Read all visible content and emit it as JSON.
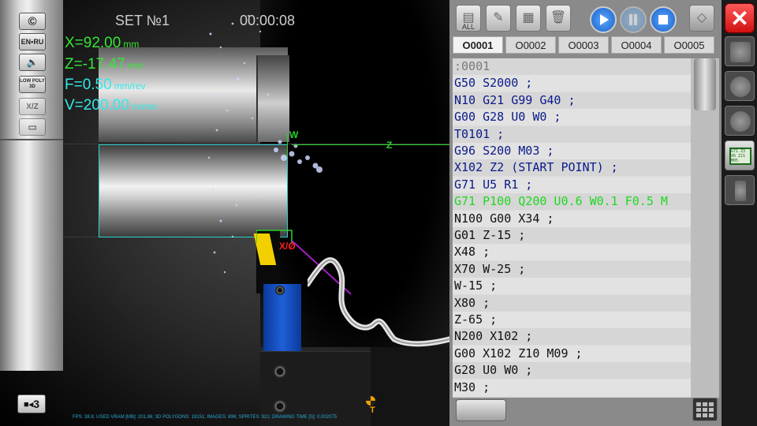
{
  "viewport": {
    "set_label": "SET №1",
    "timer": "00:00:08",
    "readouts": [
      {
        "label": "X=92.00",
        "unit": "mm",
        "color": "green"
      },
      {
        "label": "Z=-17.47",
        "unit": "mm",
        "color": "green"
      },
      {
        "label": "F=0.50",
        "unit": "mm/rev",
        "color": "cyan"
      },
      {
        "label": "V=200.00",
        "unit": "m/min",
        "color": "cyan"
      }
    ],
    "left_buttons": [
      "©",
      "EN•RU",
      "🔈",
      "LOW POLY 3D",
      "X/Z",
      "▭"
    ],
    "axis_w": "W",
    "axis_z": "Z",
    "tool_axis": "X/Ø",
    "marker_t": "T",
    "camera_button": "3",
    "status_bar": "FPS: 38.8; USED VRAM [MB]: 201.86; 3D POLYGONS: 19151; IMAGES: 896; SPRITES: 921; DRAWING TIME [S]: 0.002075"
  },
  "editor": {
    "toolbar": [
      {
        "name": "new-all-icon",
        "label": "ALL"
      },
      {
        "name": "edit-icon",
        "label": ""
      },
      {
        "name": "paste-icon",
        "label": ""
      },
      {
        "name": "trash-icon",
        "label": ""
      },
      {
        "name": "play-icon",
        "label": ""
      },
      {
        "name": "pause-icon",
        "label": ""
      },
      {
        "name": "stop-icon",
        "label": ""
      },
      {
        "name": "eraser-icon",
        "label": ""
      }
    ],
    "tabs": [
      "O0001",
      "O0002",
      "O0003",
      "O0004",
      "O0005"
    ],
    "active_tab": 0,
    "lines": [
      {
        "text": ":0001",
        "color": "#7a7a7a"
      },
      {
        "text": "G50 S2000 ;",
        "color": "#0a1a8a"
      },
      {
        "text": "N10 G21 G99 G40 ;",
        "color": "#0a1a8a"
      },
      {
        "text": "G00 G28 U0 W0 ;",
        "color": "#0a1a8a"
      },
      {
        "text": "T0101 ;",
        "color": "#0a1a8a"
      },
      {
        "text": "G96 S200 M03 ;",
        "color": "#0a1a8a"
      },
      {
        "text": "X102 Z2 (START POINT) ;",
        "color": "#0a1a8a"
      },
      {
        "text": "G71 U5 R1 ;",
        "color": "#0a1a8a"
      },
      {
        "text": "G71 P100 Q200 U0.6 W0.1 F0.5 M",
        "color": "#22d622"
      },
      {
        "text": "N100 G00 X34 ;",
        "color": "#111111"
      },
      {
        "text": "G01 Z-15 ;",
        "color": "#111111"
      },
      {
        "text": "X48 ;",
        "color": "#111111"
      },
      {
        "text": "X70 W-25 ;",
        "color": "#111111"
      },
      {
        "text": "W-15 ;",
        "color": "#111111"
      },
      {
        "text": "X80 ;",
        "color": "#111111"
      },
      {
        "text": "Z-65 ;",
        "color": "#111111"
      },
      {
        "text": "N200 X102 ;",
        "color": "#111111"
      },
      {
        "text": "G00 X102 Z10 M09 ;",
        "color": "#111111"
      },
      {
        "text": "G28 U0 W0 ;",
        "color": "#111111"
      },
      {
        "text": "M30 ;",
        "color": "#111111"
      }
    ]
  },
  "right_panel": {
    "close_label": "✕",
    "buttons": [
      "folder-icon",
      "tool-icon",
      "chuck-icon",
      "program-icon",
      "key-icon"
    ],
    "active_button": 3,
    "program_icon_text": "G71 Z3\nX6 Z21\nM05"
  }
}
